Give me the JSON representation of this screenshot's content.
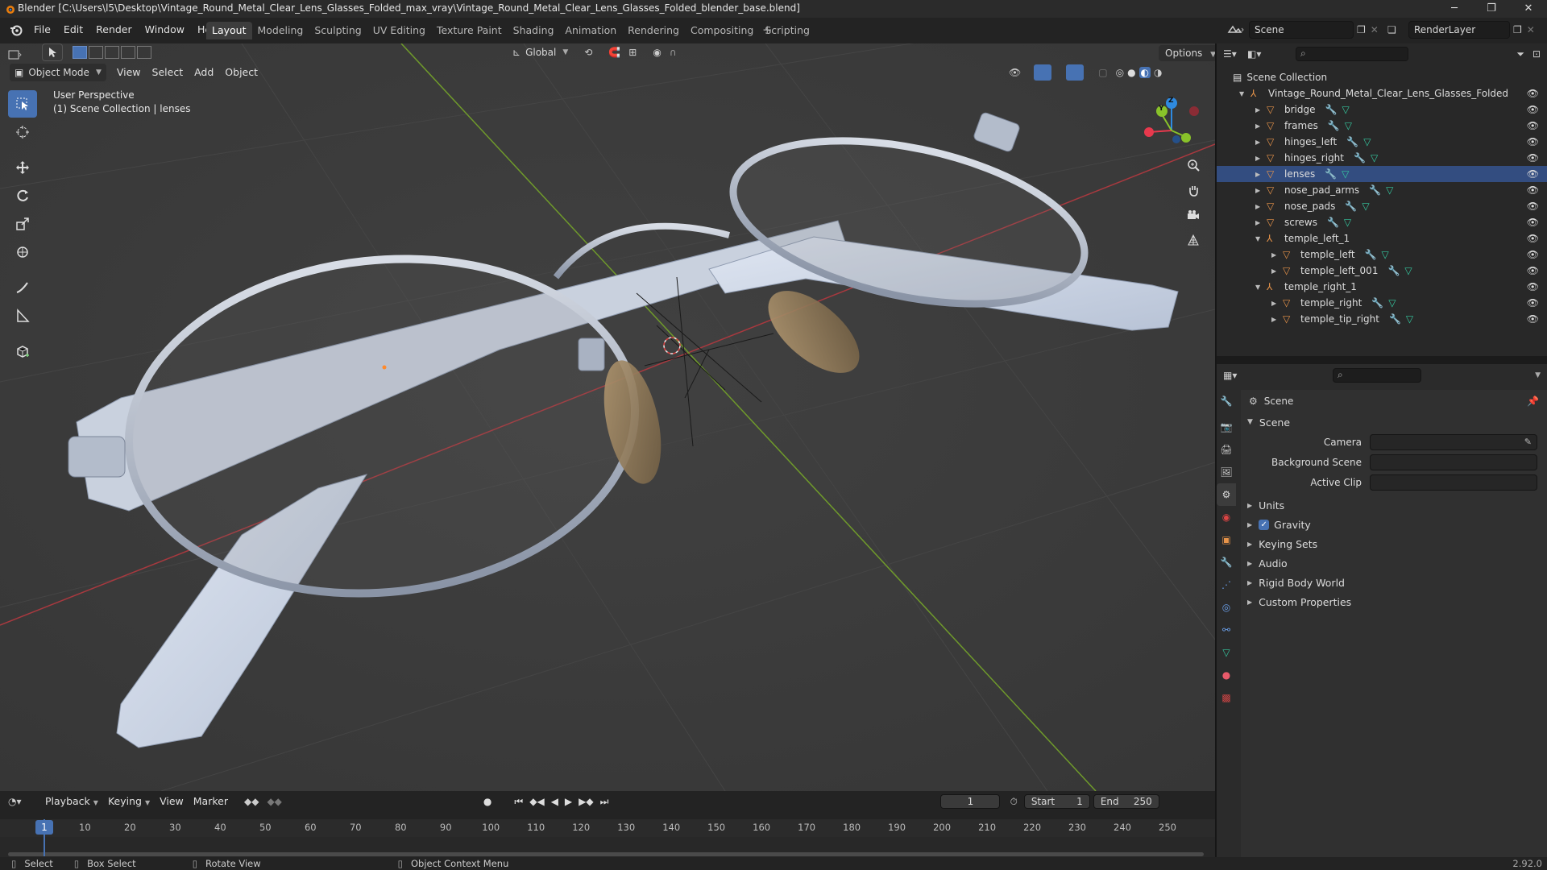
{
  "window": {
    "title": "Blender [C:\\Users\\l5\\Desktop\\Vintage_Round_Metal_Clear_Lens_Glasses_Folded_max_vray\\Vintage_Round_Metal_Clear_Lens_Glasses_Folded_blender_base.blend]"
  },
  "menu": [
    "File",
    "Edit",
    "Render",
    "Window",
    "Help"
  ],
  "workspaces": [
    "Layout",
    "Modeling",
    "Sculpting",
    "UV Editing",
    "Texture Paint",
    "Shading",
    "Animation",
    "Rendering",
    "Compositing",
    "Scripting"
  ],
  "active_workspace": "Layout",
  "scene_field": "Scene",
  "view_layer_field": "RenderLayer",
  "viewport": {
    "mode": "Object Mode",
    "header_menus": [
      "View",
      "Select",
      "Add",
      "Object"
    ],
    "transform_orientation": "Global",
    "options_label": "Options",
    "overlay_line1": "User Perspective",
    "overlay_line2": "(1) Scene Collection | lenses",
    "gizmo_labels": {
      "z": "Z",
      "y": "Y"
    }
  },
  "outliner": {
    "root": "Scene Collection",
    "items": [
      {
        "label": "Vintage_Round_Metal_Clear_Lens_Glasses_Folded",
        "depth": 1,
        "expanded": true,
        "type": "empty"
      },
      {
        "label": "bridge",
        "depth": 2,
        "type": "mesh"
      },
      {
        "label": "frames",
        "depth": 2,
        "type": "mesh"
      },
      {
        "label": "hinges_left",
        "depth": 2,
        "type": "mesh"
      },
      {
        "label": "hinges_right",
        "depth": 2,
        "type": "mesh"
      },
      {
        "label": "lenses",
        "depth": 2,
        "type": "mesh",
        "active": true
      },
      {
        "label": "nose_pad_arms",
        "depth": 2,
        "type": "mesh"
      },
      {
        "label": "nose_pads",
        "depth": 2,
        "type": "mesh"
      },
      {
        "label": "screws",
        "depth": 2,
        "type": "mesh"
      },
      {
        "label": "temple_left_1",
        "depth": 2,
        "expanded": true,
        "type": "empty"
      },
      {
        "label": "temple_left",
        "depth": 3,
        "type": "mesh"
      },
      {
        "label": "temple_left_001",
        "depth": 3,
        "type": "mesh"
      },
      {
        "label": "temple_right_1",
        "depth": 2,
        "expanded": true,
        "type": "empty"
      },
      {
        "label": "temple_right",
        "depth": 3,
        "type": "mesh"
      },
      {
        "label": "temple_tip_right",
        "depth": 3,
        "type": "mesh"
      }
    ]
  },
  "properties": {
    "context": "Scene",
    "panel": "Scene",
    "fields": [
      {
        "label": "Camera",
        "value": ""
      },
      {
        "label": "Background Scene",
        "value": ""
      },
      {
        "label": "Active Clip",
        "value": ""
      }
    ],
    "sections": [
      "Units",
      "Gravity",
      "Keying Sets",
      "Audio",
      "Rigid Body World",
      "Custom Properties"
    ],
    "gravity_checked": true
  },
  "timeline": {
    "menus": [
      "Playback",
      "Keying",
      "View",
      "Marker"
    ],
    "current_frame": "1",
    "start_label": "Start",
    "start": "1",
    "end_label": "End",
    "end": "250",
    "ruler": [
      "1",
      "10",
      "20",
      "30",
      "40",
      "50",
      "60",
      "70",
      "80",
      "90",
      "100",
      "110",
      "120",
      "130",
      "140",
      "150",
      "160",
      "170",
      "180",
      "190",
      "200",
      "210",
      "220",
      "230",
      "240",
      "250"
    ]
  },
  "statusbar": {
    "select": "Select",
    "box_select": "Box Select",
    "rotate_view": "Rotate View",
    "context_menu": "Object Context Menu",
    "version": "2.92.0"
  },
  "colors": {
    "accent": "#4772b3",
    "mesh_icon": "#e8944a",
    "modifier_icon": "#6a9ee8",
    "data_icon": "#35c9a0",
    "axis_x": "#e8394d",
    "axis_y": "#89c22a",
    "axis_z": "#2e8ae0"
  }
}
